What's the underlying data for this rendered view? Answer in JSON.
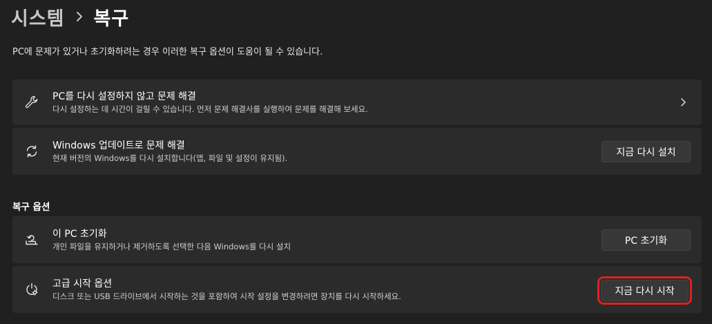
{
  "breadcrumb": {
    "parent": "시스템",
    "separator_icon": "chevron-right-icon",
    "current": "복구"
  },
  "page_description": "PC에 문제가 있거나 초기화하려는 경우 이러한 복구 옵션이 도움이 될 수 있습니다.",
  "fix_without_reset": {
    "icon": "wrench-icon",
    "title": "PC를 다시 설정하지 않고 문제 해결",
    "subtitle": "다시 설정하는 데 시간이 걸릴 수 있습니다. 먼저 문제 해결사를 실행하여 문제를 해결해 보세요.",
    "trailing_icon": "chevron-right-icon"
  },
  "windows_update_fix": {
    "icon": "sync-icon",
    "title": "Windows 업데이트로 문제 해결",
    "subtitle": "현재 버전의 Windows를 다시 설치합니다(앱, 파일 및 설정이 유지됨).",
    "button_label": "지금 다시 설치"
  },
  "recovery_options": {
    "header": "복구 옵션",
    "reset_pc": {
      "icon": "reset-pc-icon",
      "title": "이 PC 초기화",
      "subtitle": "개인 파일을 유지하거나 제거하도록 선택한 다음 Windows를 다시 설치",
      "button_label": "PC 초기화"
    },
    "advanced_startup": {
      "icon": "advanced-startup-icon",
      "title": "고급 시작 옵션",
      "subtitle": "디스크 또는 USB 드라이브에서 시작하는 것을 포함하여 시작 설정을 변경하려면 장치를 다시 시작하세요.",
      "button_label": "지금 다시 시작",
      "highlight_color": "#e02020"
    }
  },
  "colors": {
    "background": "#202020",
    "card": "#2b2b2b",
    "button": "#373737"
  }
}
